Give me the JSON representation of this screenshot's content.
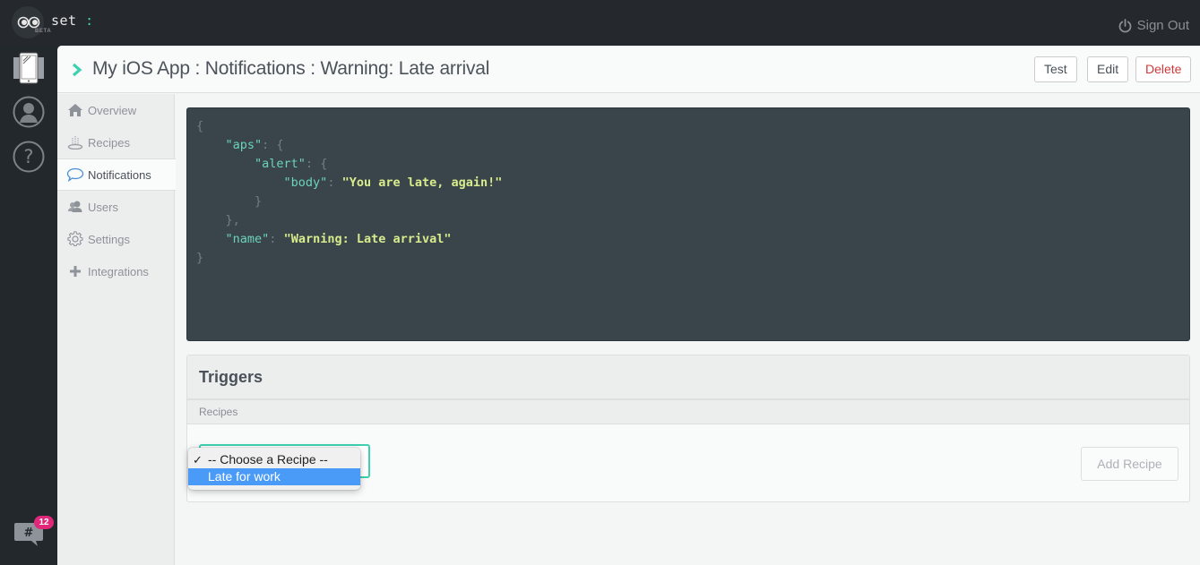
{
  "app": {
    "logo_text": "set",
    "logo_colon": ":",
    "beta_label": "BETA",
    "sign_out_label": "Sign Out",
    "accent_color": "#3ed0b0"
  },
  "rail": {
    "items": [
      {
        "icon": "device-icon",
        "label": "Apps"
      },
      {
        "icon": "user-icon",
        "label": "Account"
      },
      {
        "icon": "help-icon",
        "label": "Help"
      }
    ],
    "chat_badge_count": "12"
  },
  "header": {
    "title": "My iOS App : Notifications : Warning: Late arrival",
    "buttons": {
      "test": "Test",
      "edit": "Edit",
      "delete": "Delete"
    }
  },
  "sidebar": {
    "items": [
      {
        "label": "Overview",
        "icon": "home-icon",
        "active": false
      },
      {
        "label": "Recipes",
        "icon": "recipes-icon",
        "active": false
      },
      {
        "label": "Notifications",
        "icon": "speech-bubble-icon",
        "active": true
      },
      {
        "label": "Users",
        "icon": "users-icon",
        "active": false
      },
      {
        "label": "Settings",
        "icon": "gear-icon",
        "active": false
      },
      {
        "label": "Integrations",
        "icon": "plus-icon",
        "active": false
      }
    ]
  },
  "payload": {
    "lines": [
      [
        {
          "t": "p",
          "v": "{"
        }
      ],
      [
        {
          "t": "p",
          "v": "    "
        },
        {
          "t": "k",
          "v": "\"aps\""
        },
        {
          "t": "p",
          "v": ": {"
        }
      ],
      [
        {
          "t": "p",
          "v": "        "
        },
        {
          "t": "k",
          "v": "\"alert\""
        },
        {
          "t": "p",
          "v": ": {"
        }
      ],
      [
        {
          "t": "p",
          "v": "            "
        },
        {
          "t": "k",
          "v": "\"body\""
        },
        {
          "t": "p",
          "v": ": "
        },
        {
          "t": "s",
          "v": "\"You are late, again!\""
        }
      ],
      [
        {
          "t": "p",
          "v": "        }"
        }
      ],
      [
        {
          "t": "p",
          "v": "    },"
        }
      ],
      [
        {
          "t": "p",
          "v": "    "
        },
        {
          "t": "k",
          "v": "\"name\""
        },
        {
          "t": "p",
          "v": ": "
        },
        {
          "t": "s",
          "v": "\"Warning: Late arrival\""
        }
      ],
      [
        {
          "t": "p",
          "v": "}"
        }
      ]
    ]
  },
  "triggers": {
    "title": "Triggers",
    "subheader": "Recipes",
    "add_recipe_label": "Add Recipe",
    "select": {
      "options": [
        {
          "label": "-- Choose a Recipe --",
          "checked": true,
          "highlighted": false
        },
        {
          "label": "Late for work",
          "checked": false,
          "highlighted": true
        }
      ],
      "check_glyph": "✓"
    }
  }
}
